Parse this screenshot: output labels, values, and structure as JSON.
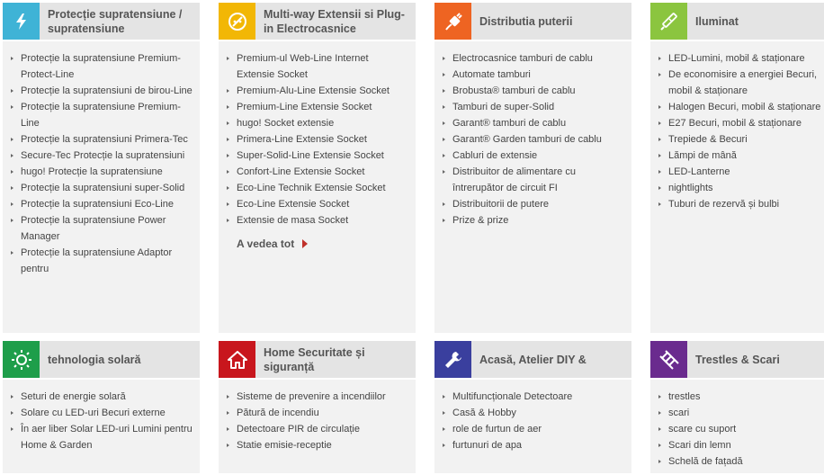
{
  "categories": [
    {
      "title": "Protecție supratensiune / supratensiune",
      "icon": "lightning-icon",
      "color": "#3fb3d6",
      "items": [
        "Protecție la supratensiune Premium-Protect-Line",
        "Protecție la supratensiuni de birou-Line",
        "Protecție la supratensiune Premium-Line",
        "Protecție la supratensiuni Primera-Tec",
        "Secure-Tec Protecție la supratensiuni",
        "hugo! Protecție la supratensiune",
        "Protecție la supratensiuni super-Solid",
        "Protecție la supratensiuni Eco-Line",
        "Protecție la supratensiune Power Manager",
        "Protecție la supratensiune Adaptor pentru"
      ]
    },
    {
      "title": "Multi-way Extensii si Plug-in Electrocasnice",
      "icon": "plug-socket-icon",
      "color": "#f2b705",
      "items": [
        "Premium-ul Web-Line Internet Extensie Socket",
        "Premium-Alu-Line Extensie Socket",
        "Premium-Line Extensie Socket",
        "hugo! Socket extensie",
        "Primera-Line Extensie Socket",
        "Super-Solid-Line Extensie Socket",
        "Confort-Line Extensie Socket",
        "Eco-Line Technik Extensie Socket",
        "Eco-Line Extensie Socket",
        "Extensie de masa Socket"
      ],
      "see_all": "A vedea tot"
    },
    {
      "title": "Distributia puterii",
      "icon": "power-plug-icon",
      "color": "#ee6422",
      "items": [
        "Electrocasnice tamburi de cablu",
        "Automate tamburi",
        "Brobusta® tamburi de cablu",
        "Tamburi de super-Solid",
        "Garant® tamburi de cablu",
        "Garant® Garden tamburi de cablu",
        "Cabluri de extensie",
        "Distribuitor de alimentare cu întrerupător de circuit FI",
        "Distribuitorii de putere",
        "Prize & prize"
      ]
    },
    {
      "title": "Iluminat",
      "icon": "pen-light-icon",
      "color": "#8bc53f",
      "items": [
        "LED-Lumini, mobil & staționare",
        "De economisire a energiei Becuri, mobil & staționare",
        "Halogen Becuri, mobil & staționare",
        "E27 Becuri, mobil & staționare",
        "Trepiede & Becuri",
        "Lămpi de mână",
        "LED-Lanterne",
        "nightlights",
        "Tuburi de rezervă și bulbi"
      ]
    },
    {
      "title": "tehnologia solară",
      "icon": "sun-icon",
      "color": "#1e9e4a",
      "items": [
        "Seturi de energie solară",
        "Solare cu LED-uri Becuri externe",
        "În aer liber Solar LED-uri Lumini pentru Home & Garden"
      ]
    },
    {
      "title": "Home Securitate și siguranță",
      "icon": "home-icon",
      "color": "#c8161d",
      "items": [
        "Sisteme de prevenire a incendiilor",
        "Pătură de incendiu",
        "Detectoare PIR de circulație",
        "Statie emisie-receptie"
      ]
    },
    {
      "title": "Acasă, Atelier DIY &",
      "icon": "wrench-icon",
      "color": "#3a3f9e",
      "items": [
        "Multifuncționale Detectoare",
        "Casă & Hobby",
        "role de furtun de aer",
        "furtunuri de apa"
      ]
    },
    {
      "title": "Trestles & Scari",
      "icon": "ladder-icon",
      "color": "#6a2b8e",
      "items": [
        "trestles",
        "scari",
        "scare cu suport",
        "Scari din lemn",
        "Schelă de fațadă"
      ]
    }
  ]
}
